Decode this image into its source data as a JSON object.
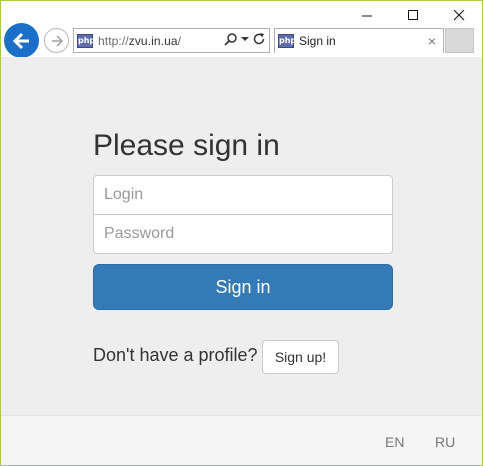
{
  "browser": {
    "address": {
      "protocol": "http://",
      "domain": "zvu.in.ua",
      "path": "/"
    },
    "favicon_text": "php",
    "tab": {
      "title": "Sign in",
      "close_label": "×"
    },
    "colors": {
      "back_button": "#1c6fc8",
      "window_border": "#a8c94a"
    }
  },
  "form": {
    "heading": "Please sign in",
    "login_placeholder": "Login",
    "password_placeholder": "Password",
    "submit_label": "Sign in",
    "signup_prompt": "Don't have a profile?",
    "signup_label": "Sign up!"
  },
  "footer": {
    "languages": [
      "EN",
      "RU"
    ]
  },
  "colors": {
    "primary_button": "#337ab7",
    "page_background": "#eeeeee"
  }
}
